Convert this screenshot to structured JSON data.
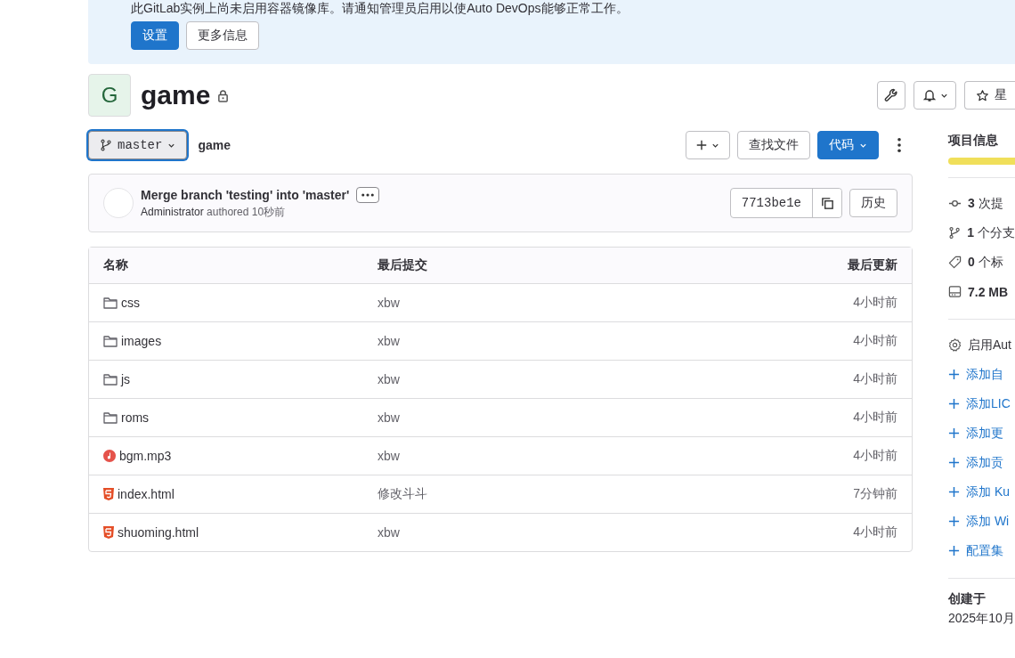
{
  "banner": {
    "message": "此GitLab实例上尚未启用容器镜像库。请通知管理员启用以使Auto DevOps能够正常工作。",
    "buttons": [
      {
        "label": "设置",
        "kind": "primary"
      },
      {
        "label": "更多信息",
        "kind": "default"
      }
    ]
  },
  "project": {
    "avatar_letter": "G",
    "name": "game",
    "private": true,
    "star_label": "星"
  },
  "repo_bar": {
    "branch": "master",
    "path": "game",
    "find_file": "查找文件",
    "code": "代码"
  },
  "last_commit": {
    "title": "Merge branch 'testing' into 'master'",
    "author": "Administrator",
    "meta": "authored 10秒前",
    "sha": "7713be1e",
    "history": "历史"
  },
  "table": {
    "columns": [
      "名称",
      "最后提交",
      "最后更新"
    ],
    "rows": [
      {
        "name": "css",
        "kind": "folder",
        "commit": "xbw",
        "updated": "4小时前"
      },
      {
        "name": "images",
        "kind": "folder",
        "commit": "xbw",
        "updated": "4小时前"
      },
      {
        "name": "js",
        "kind": "folder",
        "commit": "xbw",
        "updated": "4小时前"
      },
      {
        "name": "roms",
        "kind": "folder",
        "commit": "xbw",
        "updated": "4小时前"
      },
      {
        "name": "bgm.mp3",
        "kind": "audio",
        "commit": "xbw",
        "updated": "4小时前"
      },
      {
        "name": "index.html",
        "kind": "html",
        "commit": "修改斗斗",
        "updated": "7分钟前"
      },
      {
        "name": "shuoming.html",
        "kind": "html",
        "commit": "xbw",
        "updated": "4小时前"
      }
    ]
  },
  "sidebar": {
    "title": "项目信息",
    "stats": [
      {
        "kind": "commit",
        "count": "3",
        "label": "次提"
      },
      {
        "kind": "branch",
        "count": "1",
        "label": "个分支"
      },
      {
        "kind": "tag",
        "count": "0",
        "label": "个标"
      },
      {
        "kind": "storage",
        "count": "7.2 MB"
      }
    ],
    "language_bar": {
      "level": 1
    },
    "actions": [
      {
        "kind": "settings",
        "label": "启用Aut"
      },
      {
        "kind": "add",
        "label": "添加自"
      },
      {
        "kind": "add",
        "label": "添加LIC"
      },
      {
        "kind": "add",
        "label": "添加更"
      },
      {
        "kind": "add",
        "label": "添加贡"
      },
      {
        "kind": "add",
        "label": "添加 Ku"
      },
      {
        "kind": "add",
        "label": "添加 Wi"
      },
      {
        "kind": "add",
        "label": "配置集"
      }
    ],
    "created_title": "创建于",
    "created_value": "2025年10月"
  }
}
